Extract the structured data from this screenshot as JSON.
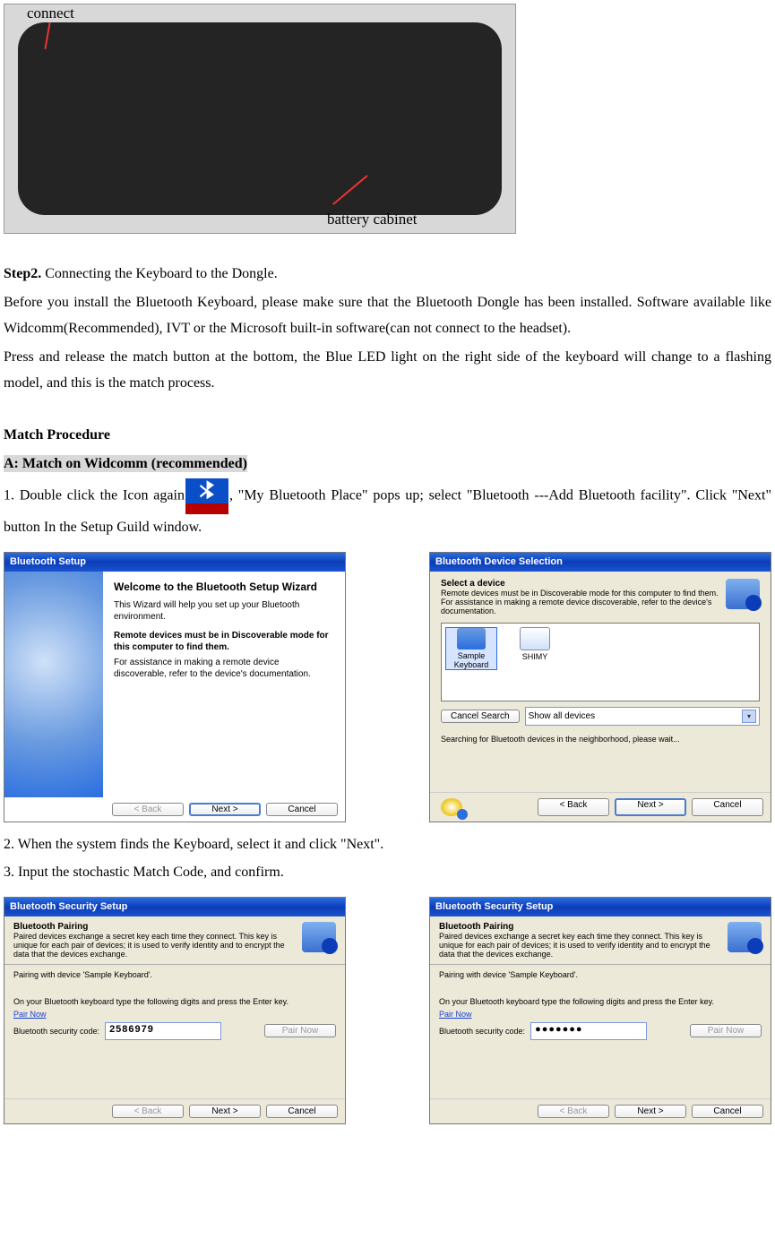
{
  "photo": {
    "label_connect": "connect",
    "label_battery": "battery cabinet"
  },
  "text": {
    "step2_label": "Step2.",
    "step2_rest": " Connecting the Keyboard to the Dongle.",
    "para1": "Before you install the Bluetooth Keyboard, please make sure that the Bluetooth Dongle has been installed. Software available like Widcomm(Recommended), IVT or the Microsoft built-in software(can not connect to the headset).",
    "para2": "Press and release the match button at the bottom, the Blue LED light on the right side of the keyboard will change to a flashing model, and this is the match process.",
    "mp_title": "Match Procedure",
    "section_a": "A: Match on Widcomm (recommended)",
    "step1a": "1. Double click the Icon again",
    "step1b": ", \"My Bluetooth Place\" pops up; select \"Bluetooth ---Add Bluetooth facility\". Click \"Next\" button In the Setup Guild window.",
    "step_find": "2. When the system finds the Keyboard, select it and click \"Next\".",
    "step_code": "3. Input the stochastic Match Code, and confirm."
  },
  "win1": {
    "title": "Bluetooth Setup",
    "heading": "Welcome to the Bluetooth Setup Wizard",
    "line1": "This Wizard will help you set up your Bluetooth environment.",
    "bold1": "Remote devices must be in Discoverable mode for this computer to find them.",
    "line2": "For assistance in making a remote device discoverable, refer to the device's documentation.",
    "btn_back": "< Back",
    "btn_next": "Next >",
    "btn_cancel": "Cancel"
  },
  "win2": {
    "title": "Bluetooth Device Selection",
    "heading": "Select a device",
    "sub": "Remote devices must be in Discoverable mode for this computer to find them. For assistance in making a remote device discoverable, refer to the device's documentation.",
    "dev1": "Sample Keyboard",
    "dev2": "SHIMY",
    "btn_cancel_search": "Cancel Search",
    "filter": "Show all devices",
    "searching": "Searching for Bluetooth devices in the neighborhood, please wait...",
    "btn_back": "< Back",
    "btn_next": "Next >",
    "btn_cancel": "Cancel"
  },
  "win3": {
    "title": "Bluetooth Security Setup",
    "heading": "Bluetooth Pairing",
    "sub": "Paired devices exchange a secret key each time they connect. This key is unique for each pair of devices; it is used to verify identity and to encrypt the data that the devices exchange.",
    "pairing_with": "Pairing with device 'Sample Keyboard'.",
    "instruction": "On your Bluetooth keyboard type the following digits and press the Enter key.",
    "pair_now_link": "Pair Now",
    "code_label": "Bluetooth security code:",
    "code_value": "2586979",
    "btn_pair": "Pair Now",
    "btn_back": "< Back",
    "btn_next": "Next >",
    "btn_cancel": "Cancel"
  },
  "win4": {
    "title": "Bluetooth Security Setup",
    "heading": "Bluetooth Pairing",
    "sub": "Paired devices exchange a secret key each time they connect. This key is unique for each pair of devices; it is used to verify identity and to encrypt the data that the devices exchange.",
    "pairing_with": "Pairing with device 'Sample Keyboard'.",
    "instruction": "On your Bluetooth keyboard type the following digits and press the Enter key.",
    "pair_now_link": "Pair Now",
    "code_label": "Bluetooth security code:",
    "code_value": "●●●●●●●",
    "btn_pair": "Pair Now",
    "btn_back": "< Back",
    "btn_next": "Next >",
    "btn_cancel": "Cancel"
  }
}
